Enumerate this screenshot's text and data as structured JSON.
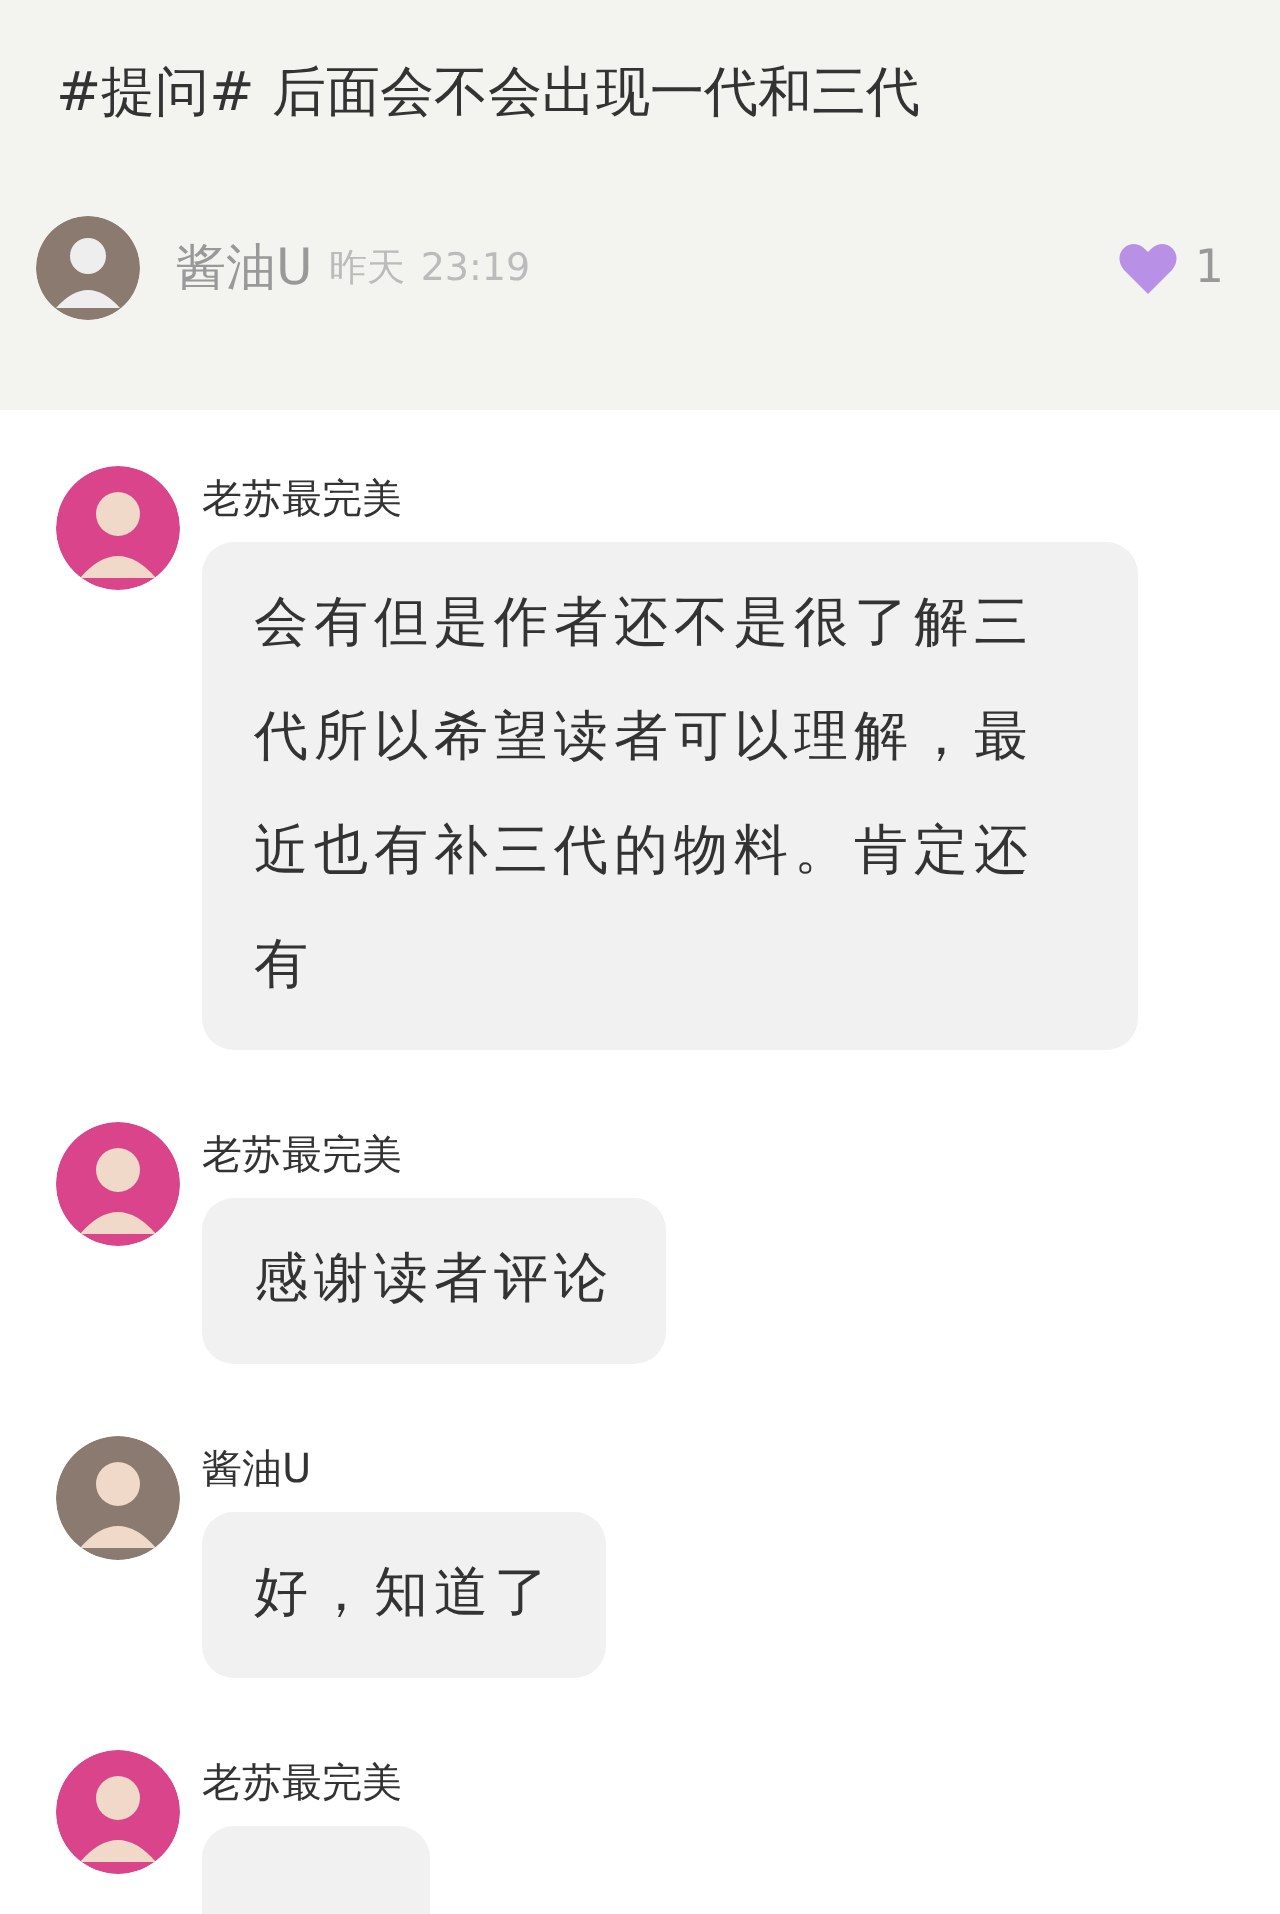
{
  "post": {
    "title": "#提问# 后面会不会出现一代和三代",
    "author": "酱油U",
    "date": "昨天",
    "time": "23:19",
    "likes": "1",
    "liked": true
  },
  "comments": [
    {
      "author": "老苏最完美",
      "color": "#d9448a",
      "text": "会有但是作者还不是很了解三代所以希望读者可以理解，最近也有补三代的物料。肯定还有"
    },
    {
      "author": "老苏最完美",
      "color": "#d9448a",
      "text": "感谢读者评论"
    },
    {
      "author": "酱油U",
      "color": "#8a7a70",
      "text": "好，知道了"
    },
    {
      "author": "老苏最完美",
      "color": "#d9448a"
    }
  ]
}
